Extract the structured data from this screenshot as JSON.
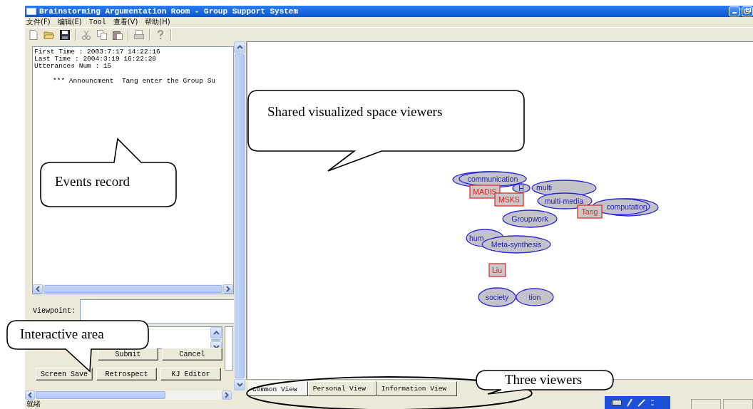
{
  "window": {
    "title": "Brainstorming Argumentation Room - Group Support System"
  },
  "menu": [
    {
      "label": "文件(F)",
      "kind": "cjk"
    },
    {
      "label": "编辑(E)",
      "kind": "cjk"
    },
    {
      "label": "Tool",
      "kind": "latin"
    },
    {
      "label": "查看(V)",
      "kind": "cjk"
    },
    {
      "label": "帮助(H)",
      "kind": "cjk"
    }
  ],
  "events_record": {
    "lines": [
      "First Time : 2003:7:17 14:22:16",
      "Last Time : 2004:3:19 16:22:28",
      "Utterances Num : 15"
    ],
    "announcement": "*** Announcment  Tang enter the Group Su"
  },
  "viewpoint": {
    "label": "Viewpoint:"
  },
  "button_rows": [
    [
      {
        "label": "Submit"
      },
      {
        "label": "Cancel"
      }
    ],
    [
      {
        "label": "Screen Save"
      },
      {
        "label": "Retrospect"
      },
      {
        "label": "KJ Editor"
      }
    ]
  ],
  "canvas_nodes": [
    {
      "kind": "concept",
      "label": "communication"
    },
    {
      "kind": "concept",
      "label": "H"
    },
    {
      "kind": "concept",
      "label": "multi"
    },
    {
      "kind": "concept",
      "label": "multi-media"
    },
    {
      "kind": "concept",
      "label": "computation"
    },
    {
      "kind": "concept",
      "label": "Groupwork"
    },
    {
      "kind": "concept",
      "label": "hum"
    },
    {
      "kind": "concept",
      "label": "Meta-synthesis"
    },
    {
      "kind": "concept",
      "label": "society"
    },
    {
      "kind": "concept",
      "label": "tion"
    },
    {
      "kind": "person",
      "label": "MADIS"
    },
    {
      "kind": "person",
      "label": "MSKS"
    },
    {
      "kind": "person",
      "label": "Tang"
    },
    {
      "kind": "person",
      "label": "Liu"
    }
  ],
  "tabs": [
    {
      "label": "Common View",
      "selected": true
    },
    {
      "label": "Personal View",
      "selected": false
    },
    {
      "label": "Information View",
      "selected": false
    }
  ],
  "status_bar": {
    "text": "就绪"
  },
  "callouts": [
    {
      "text": "Shared visualized space viewers"
    },
    {
      "text": "Events record"
    },
    {
      "text": "Interactive area"
    },
    {
      "text": "Three viewers"
    }
  ]
}
